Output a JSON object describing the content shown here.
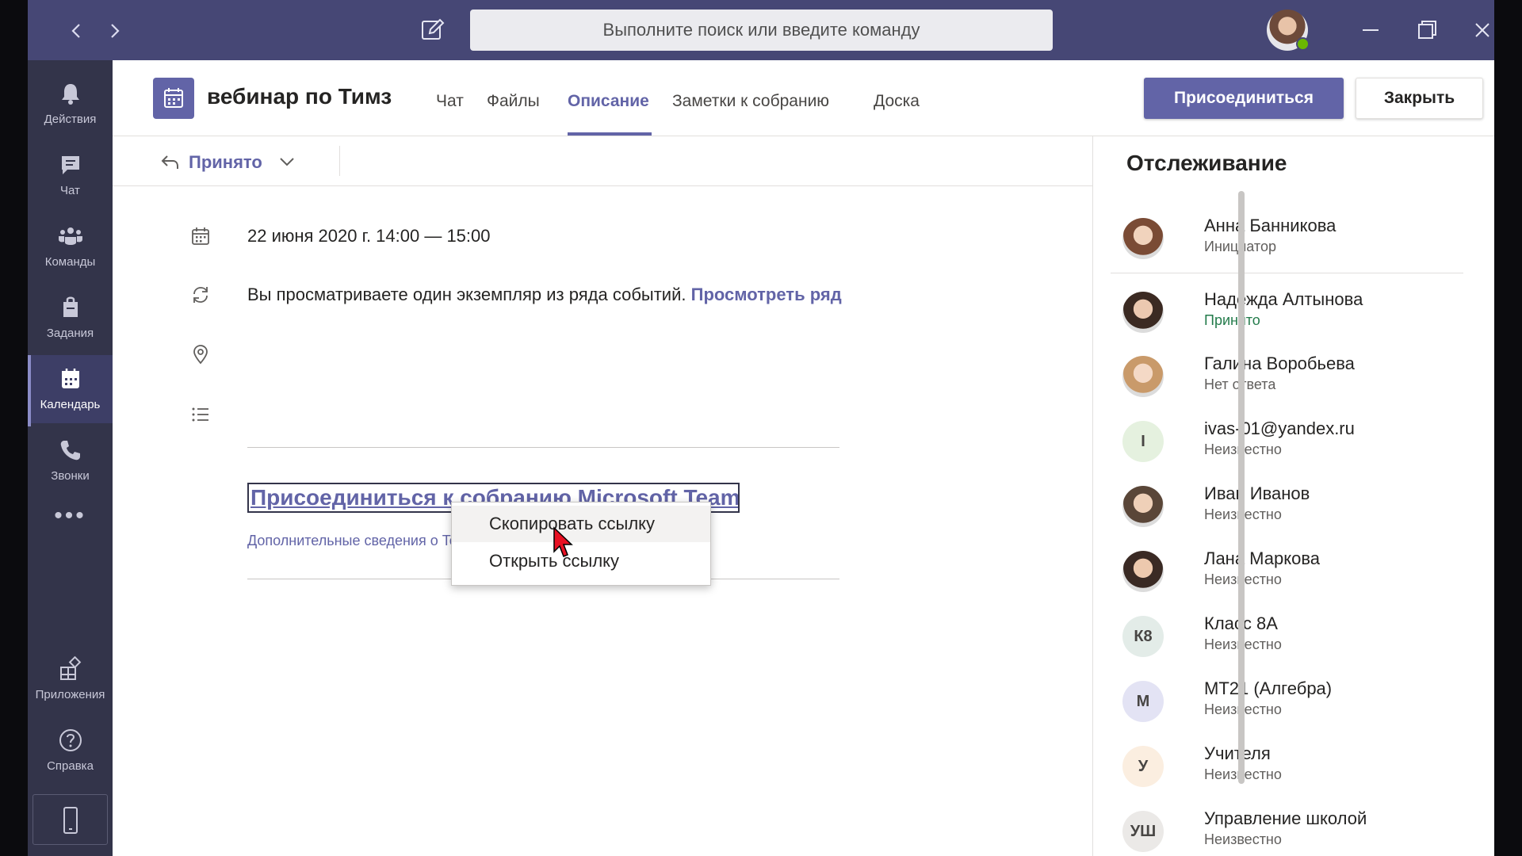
{
  "topbar": {
    "search_placeholder": "Выполните поиск или введите команду",
    "icons": [
      "back-arrow-icon",
      "forward-arrow-icon",
      "compose-icon",
      "minimize-icon",
      "maximize-icon",
      "close-window-icon"
    ]
  },
  "rail": {
    "items": [
      {
        "label": "Действия",
        "icon": "bell-icon"
      },
      {
        "label": "Чат",
        "icon": "chat-icon"
      },
      {
        "label": "Команды",
        "icon": "teams-icon"
      },
      {
        "label": "Задания",
        "icon": "assignments-icon"
      },
      {
        "label": "Календарь",
        "icon": "calendar-icon",
        "active": true
      },
      {
        "label": "Звонки",
        "icon": "phone-icon"
      },
      {
        "label": "Приложения",
        "icon": "apps-icon"
      },
      {
        "label": "Справка",
        "icon": "help-icon"
      }
    ],
    "more_label": "•••"
  },
  "header": {
    "title": "вебинар по Тимз",
    "tabs": [
      {
        "label": "Чат"
      },
      {
        "label": "Файлы"
      },
      {
        "label": "Описание",
        "active": true
      },
      {
        "label": "Заметки к собранию"
      },
      {
        "label": "Доска"
      }
    ],
    "join_label": "Присоединиться",
    "close_label": "Закрыть"
  },
  "rsvp": {
    "label": "Принято"
  },
  "details": {
    "date": "22 июня 2020 г. 14:00 — 15:00",
    "series_text": "Вы просматриваете один экземпляр из ряда событий.",
    "series_link": "Просмотреть ряд",
    "join_link": "Присоединиться к собранию Microsoft Teams",
    "more_info": "Дополнительные сведения о Tea"
  },
  "context_menu": {
    "items": [
      {
        "label": "Скопировать ссылку",
        "hover": true
      },
      {
        "label": "Открыть ссылку"
      }
    ]
  },
  "tracking": {
    "title": "Отслеживание",
    "people": [
      {
        "name": "Анна Банникова",
        "status": "Инициатор",
        "avatar": "photo"
      },
      {
        "name": "Надежда Алтынова",
        "status": "Принято",
        "avatar": "photo"
      },
      {
        "name": "Галина Воробьева",
        "status": "Нет ответа",
        "avatar": "photo"
      },
      {
        "name": "ivas-01@yandex.ru",
        "status": "Неизвестно",
        "initials": "I",
        "avatar_color": "#e5f1df"
      },
      {
        "name": "Иван Иванов",
        "status": "Неизвестно",
        "avatar": "photo"
      },
      {
        "name": "Лана Маркова",
        "status": "Неизвестно",
        "avatar": "photo"
      },
      {
        "name": "Класс 8А",
        "status": "Неизвестно",
        "initials": "К8",
        "avatar_color": "#e3ece8"
      },
      {
        "name": "МТ21 (Алгебра)",
        "status": "Неизвестно",
        "initials": "М",
        "avatar_color": "#e3e3f4"
      },
      {
        "name": "Учителя",
        "status": "Неизвестно",
        "initials": "У",
        "avatar_color": "#fbeee0"
      },
      {
        "name": "Управление школой",
        "status": "Неизвестно",
        "initials": "УШ",
        "avatar_color": "#ebe9e7"
      }
    ]
  },
  "colors": {
    "brand": "#6264a7",
    "topbar": "#464775",
    "rail": "#33344a",
    "accepted": "#237b4b"
  }
}
